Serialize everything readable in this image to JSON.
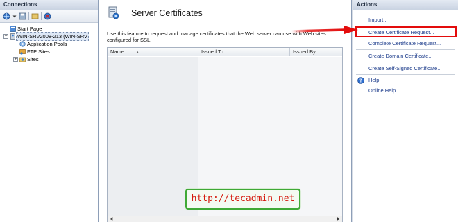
{
  "connections": {
    "header": "Connections",
    "tree": [
      {
        "label": "Start Page",
        "expander": ""
      },
      {
        "label": "WIN-SRV2008-213 (WIN-SRV",
        "expander": "−"
      },
      {
        "label": "Application Pools",
        "expander": ""
      },
      {
        "label": "FTP Sites",
        "expander": ""
      },
      {
        "label": "Sites",
        "expander": "+"
      }
    ]
  },
  "main": {
    "title": "Server Certificates",
    "description": "Use this feature to request and manage certificates that the Web server can use with Web sites configured for SSL.",
    "columns": [
      "Name",
      "Issued To",
      "Issued By"
    ],
    "sort_indicator": "▲"
  },
  "actions": {
    "header": "Actions",
    "items": [
      "Import...",
      "Create Certificate Request...",
      "Complete Certificate Request...",
      "Create Domain Certificate...",
      "Create Self-Signed Certificate...",
      "Help",
      "Online Help"
    ]
  },
  "watermark": "http://tecadmin.net",
  "colors": {
    "highlight": "#e30c0c",
    "link": "#1a3a8a",
    "watermark_border": "#3fa936"
  }
}
